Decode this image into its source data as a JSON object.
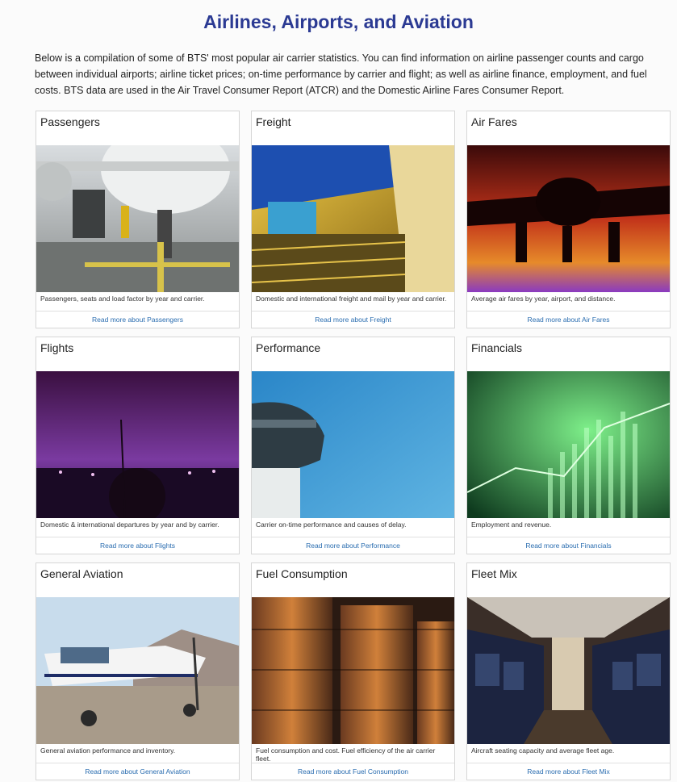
{
  "header": {
    "title": "Airlines, Airports, and Aviation",
    "intro": "Below is a compilation of some of BTS' most popular air carrier statistics. You can find information on airline passenger counts and cargo between individual airports; airline ticket prices; on-time performance by carrier and flight; as well as airline finance, employment, and fuel costs. BTS data are used in the Air Travel Consumer Report (ATCR) and the Domestic Airline Fares Consumer Report."
  },
  "cards": [
    {
      "title": "Passengers",
      "description": "Passengers, seats and load factor by year and carrier.",
      "link": "Read more about Passengers",
      "image": "airplane-on-tarmac-photo"
    },
    {
      "title": "Freight",
      "description": "Domestic and international freight and mail by year and carrier.",
      "link": "Read more about Freight",
      "image": "cargo-hold-photo"
    },
    {
      "title": "Air Fares",
      "description": "Average air fares by year, airport, and distance.",
      "link": "Read more about Air Fares",
      "image": "airplane-sunset-photo"
    },
    {
      "title": "Flights",
      "description": "Domestic & international departures by year and by carrier.",
      "link": "Read more about Flights",
      "image": "night-airport-photo"
    },
    {
      "title": "Performance",
      "description": "Carrier on-time performance and causes of delay.",
      "link": "Read more about Performance",
      "image": "control-tower-photo"
    },
    {
      "title": "Financials",
      "description": "Employment and revenue.",
      "link": "Read more about Financials",
      "image": "financial-graph-photo"
    },
    {
      "title": "General Aviation",
      "description": "General aviation performance and inventory.",
      "link": "Read more about General Aviation",
      "image": "small-plane-photo"
    },
    {
      "title": "Fuel Consumption",
      "description": "Fuel consumption and cost. Fuel efficiency of the air carrier fleet.",
      "link": "Read more about Fuel Consumption",
      "image": "fuel-tanks-photo"
    },
    {
      "title": "Fleet Mix",
      "description": "Aircraft seating capacity and average fleet age.",
      "link": "Read more about Fleet Mix",
      "image": "aircraft-cabin-photo"
    }
  ],
  "colors": {
    "title": "#2b3a93",
    "link": "#2a6db0"
  }
}
